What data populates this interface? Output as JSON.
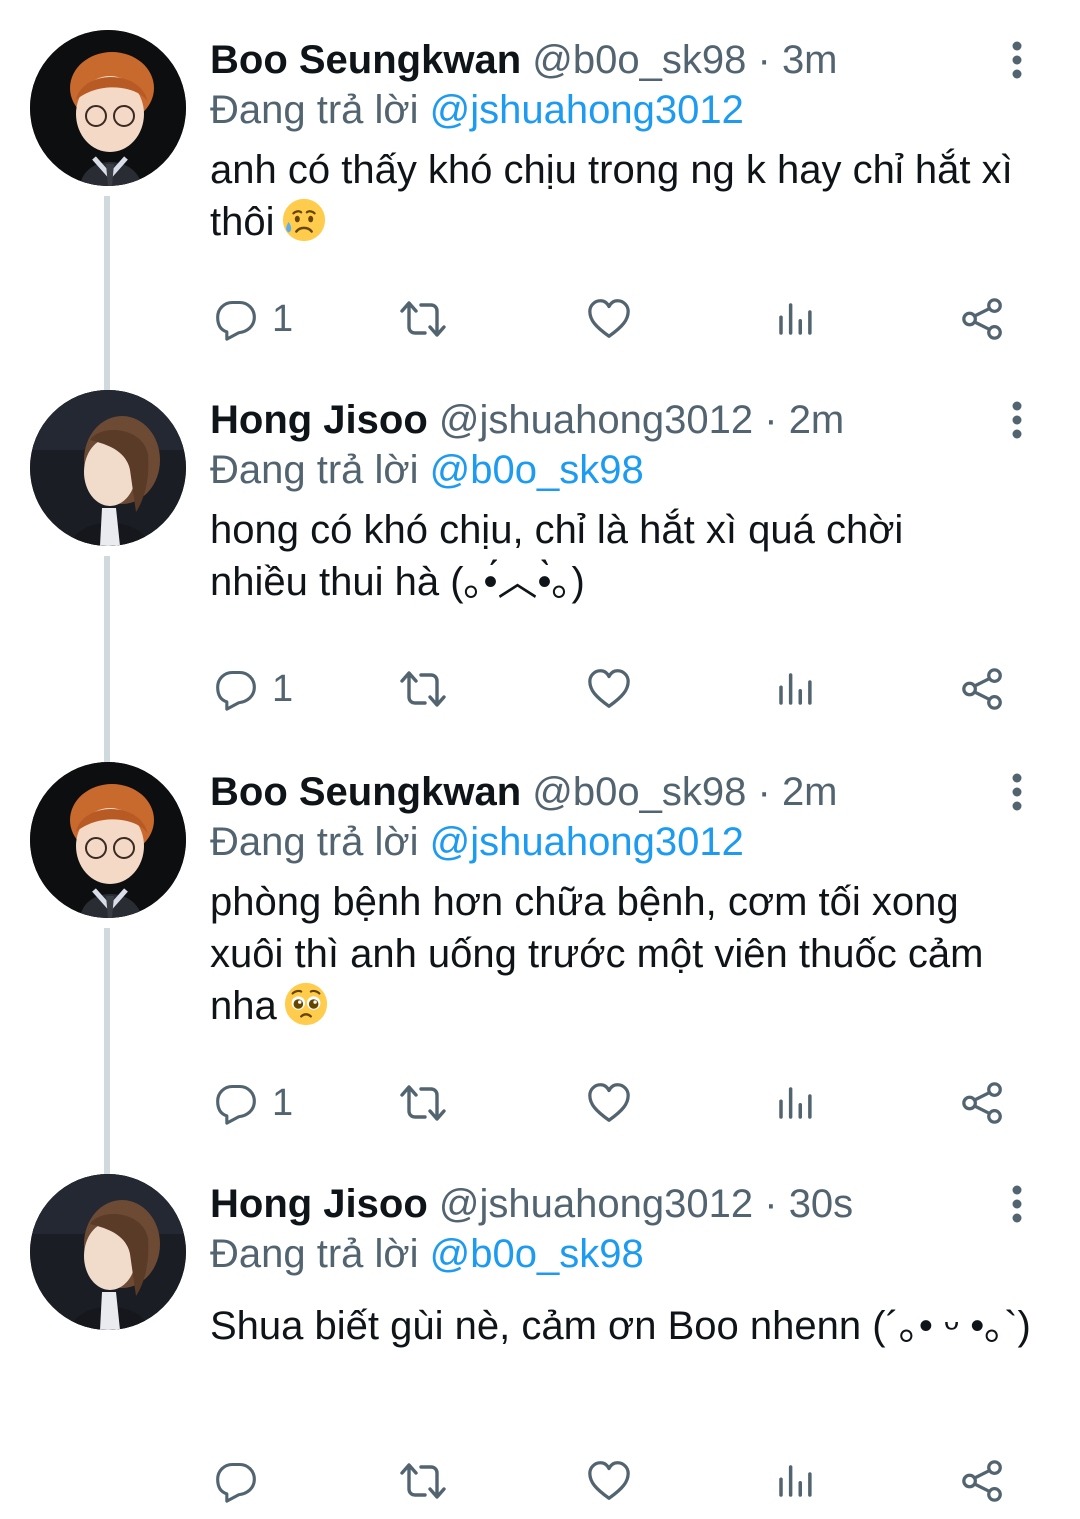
{
  "colors": {
    "text": "#0f1419",
    "secondary": "#536471",
    "link": "#1d9bf0",
    "thread_line": "#cfd9de"
  },
  "tweets": [
    {
      "name": "Boo Seungkwan",
      "handle": "@b0o_sk98",
      "separator": "·",
      "time": "3m",
      "reply_prefix": "Đang trả lời",
      "reply_to": "@jshuahong3012",
      "text": "anh có thấy khó chịu trong ng k hay chỉ hắt xì thôi",
      "emoji": "sad-relieved-face-emoji",
      "avatar": "orange-hair-glasses-avatar",
      "reply_count": "1"
    },
    {
      "name": "Hong Jisoo",
      "handle": "@jshuahong3012",
      "separator": "·",
      "time": "2m",
      "reply_prefix": "Đang trả lời",
      "reply_to": "@b0o_sk98",
      "text": "hong có khó chịu, chỉ là hắt xì quá chời nhiều thui hà (｡•́︿•̀｡)",
      "emoji": "",
      "avatar": "brown-hair-profile-avatar",
      "reply_count": "1"
    },
    {
      "name": "Boo Seungkwan",
      "handle": "@b0o_sk98",
      "separator": "·",
      "time": "2m",
      "reply_prefix": "Đang trả lời",
      "reply_to": "@jshuahong3012",
      "text": "phòng bệnh hơn chữa bệnh, cơm tối xong xuôi thì anh uống trước một viên thuốc cảm nha",
      "emoji": "pleading-face-emoji",
      "avatar": "orange-hair-glasses-avatar",
      "reply_count": "1"
    },
    {
      "name": "Hong Jisoo",
      "handle": "@jshuahong3012",
      "separator": "·",
      "time": "30s",
      "reply_prefix": "Đang trả lời",
      "reply_to": "@b0o_sk98",
      "text": "Shua biết gùi nè, cảm ơn Boo nhenn (´｡• ᵕ •｡`)",
      "emoji": "",
      "avatar": "brown-hair-profile-avatar",
      "reply_count": ""
    }
  ],
  "action_icons": [
    "reply-icon",
    "retweet-icon",
    "like-icon",
    "analytics-icon",
    "share-icon"
  ]
}
